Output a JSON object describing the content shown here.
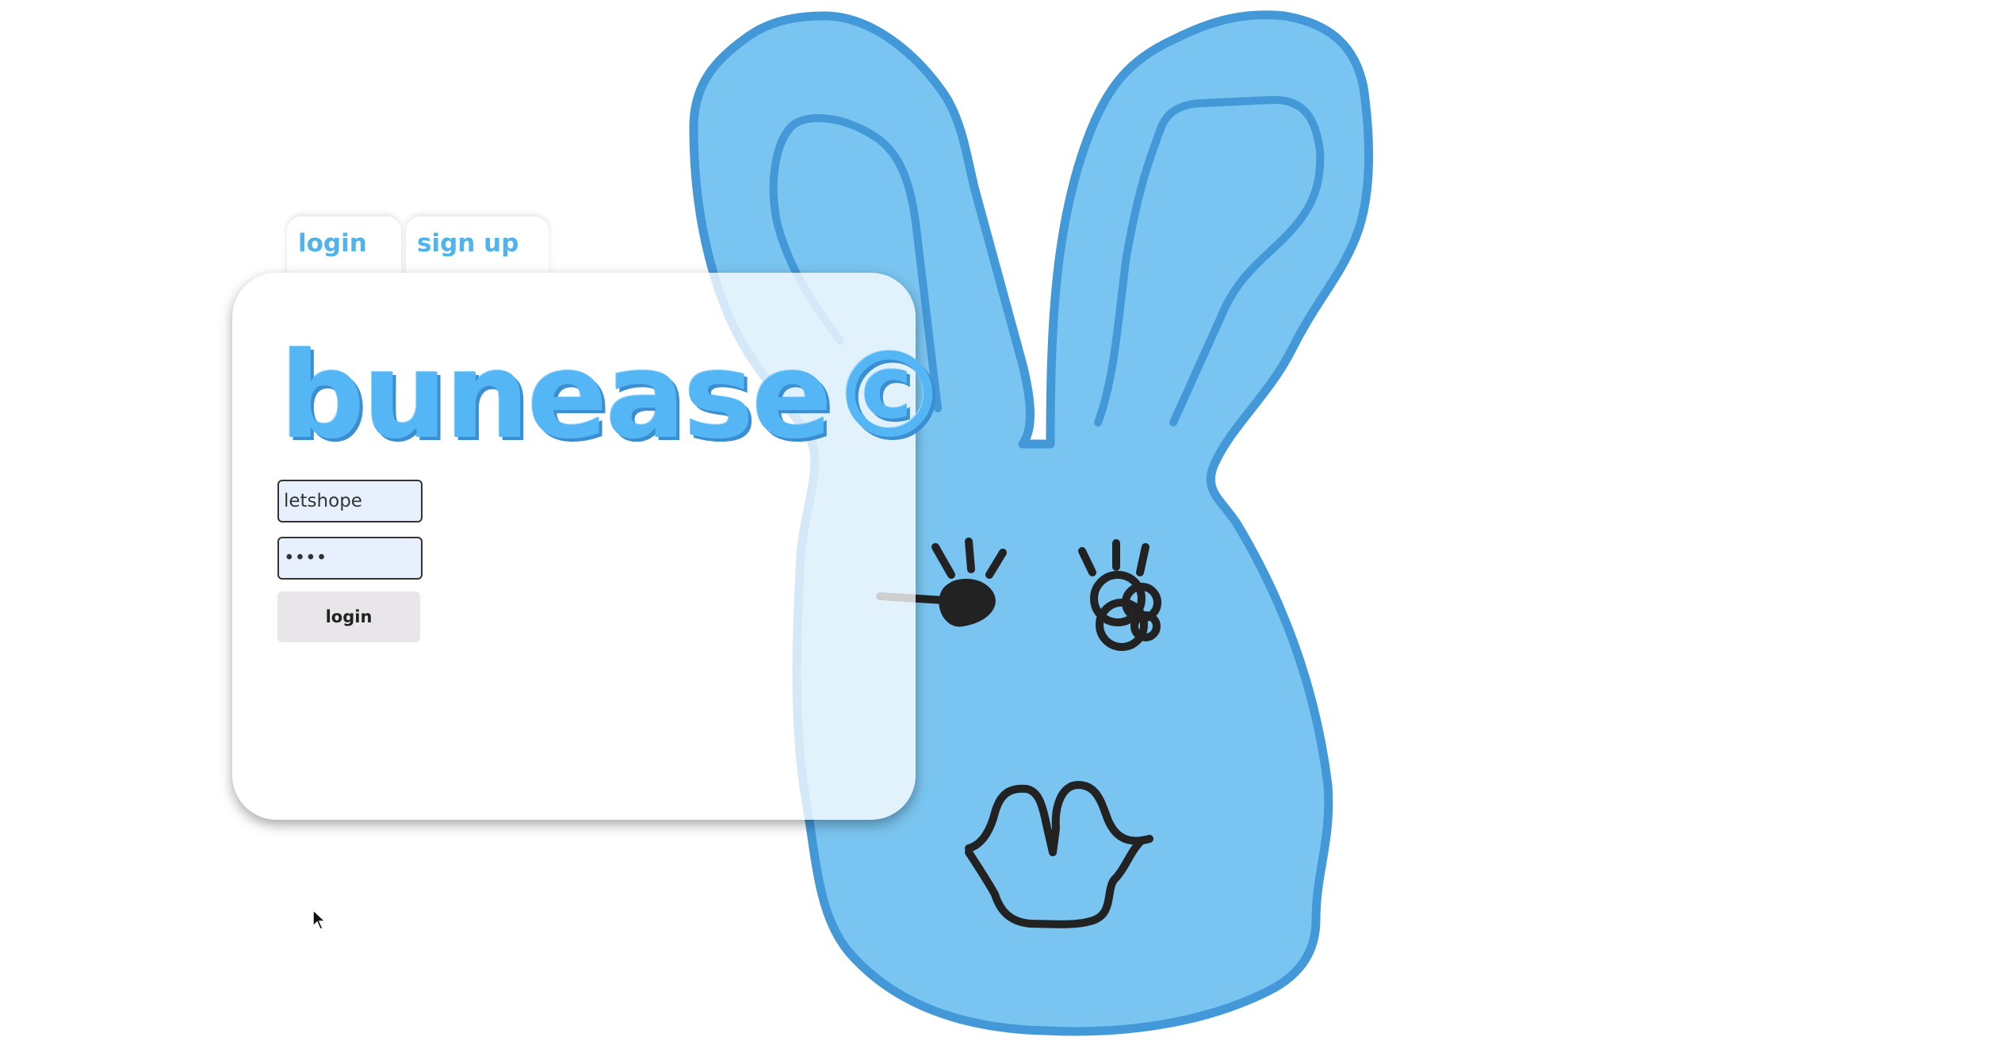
{
  "tabs": {
    "login_label": "login",
    "signup_label": "sign up"
  },
  "card": {
    "logo_text": "bunease©",
    "username_value": "letshope",
    "password_value": "••••",
    "login_button_label": "login"
  },
  "colors": {
    "accent": "#4fb4ec",
    "bunny_fill": "#79c4f0",
    "bunny_outline": "#4398d8",
    "face_ink": "#222222"
  },
  "icons": {
    "cursor": "mouse-pointer-icon"
  }
}
